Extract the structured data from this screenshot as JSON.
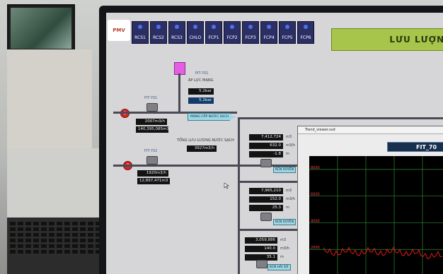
{
  "header": {
    "logo_text": "PMV",
    "tabs": [
      "RCS1",
      "RCS2",
      "RCS3",
      "CHLO",
      "FCP1",
      "FCP2",
      "FCP3",
      "FCP4",
      "FCP5",
      "FCP6"
    ],
    "title": "LƯU LƯỢNG"
  },
  "pressure": {
    "tag": "PIT-701",
    "label": "ÁP LỰC MẠNG",
    "value_1": "5.2bar",
    "value_2": "5.2bar"
  },
  "lines": [
    {
      "tag": "FIT-701",
      "pump_label": "0",
      "flow_rate": "2007m3/h",
      "total": "140,395,085m3"
    },
    {
      "tag": "FIT-702",
      "pump_label": "0",
      "flow_rate": "1920m3/h",
      "total": "12,897,471m3"
    }
  ],
  "clean_water_label": "MẠNG CẤP NƯỚC SẠCH",
  "total_flow": {
    "label": "TỔNG LƯU LƯỢNG NƯỚC SẠCH",
    "value": "3927m3/h"
  },
  "branches": [
    {
      "values": [
        "7,412,724",
        "632.0",
        "-1.8"
      ],
      "units": [
        "m3",
        "m3/h",
        "m"
      ],
      "tag": "KCN XUYÊN"
    },
    {
      "values": [
        "7,965,210",
        "152.0",
        "25.3"
      ],
      "units": [
        "m3",
        "m3/h",
        "m"
      ],
      "tag": "KCN XUYÊN"
    },
    {
      "values": [
        "3,059,886",
        "140.0",
        "35.1"
      ],
      "units": [
        "m3",
        "m3/h",
        "m"
      ],
      "tag": "KCN HẢI SƠ"
    }
  ],
  "trend": {
    "window_title": "Trend_viewer.svd",
    "fit_label": "FIT_70",
    "y_ticks": [
      "8000",
      "6000",
      "4000",
      "2000"
    ],
    "grid_color": "#2e8b2e",
    "series_color": "#e21818",
    "series_level": "about 2000 m3/h, fluctuating"
  }
}
